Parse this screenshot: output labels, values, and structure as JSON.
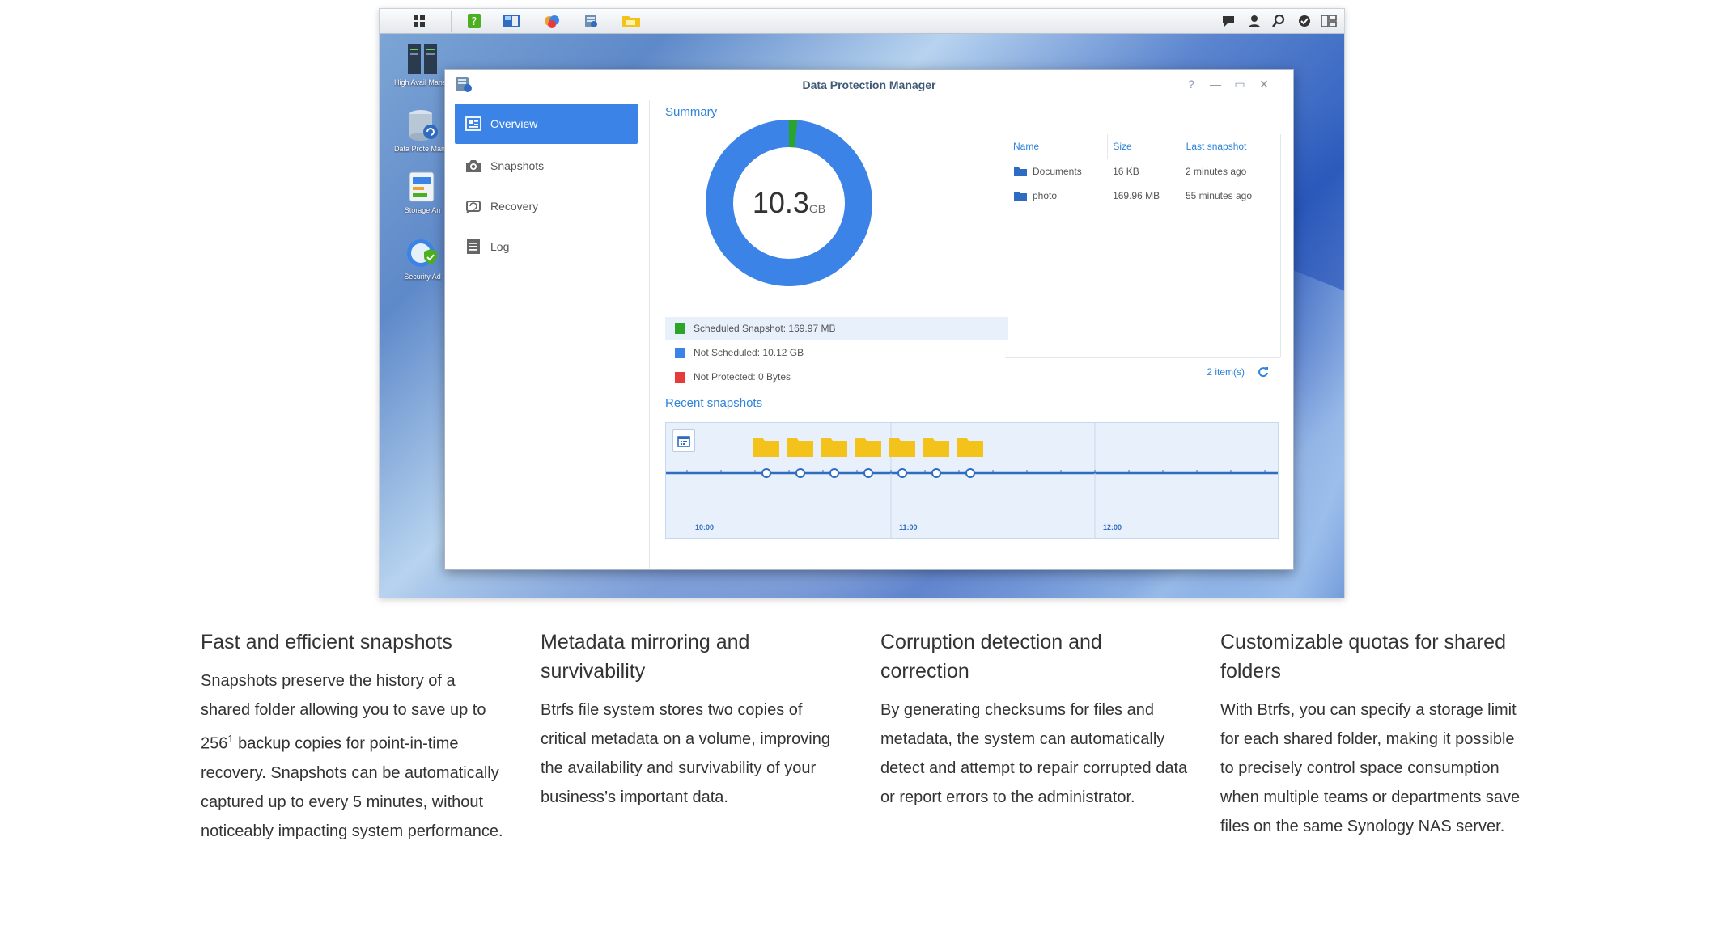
{
  "window": {
    "title": "Data Protection Manager",
    "help_label": "?",
    "minimize_label": "—",
    "maximize_label": "▭",
    "close_label": "✕"
  },
  "desktop_icons": [
    {
      "label": "High Avail Manag",
      "icon": "server-icon"
    },
    {
      "label": "Data Prote Manag",
      "icon": "database-icon"
    },
    {
      "label": "Storage An",
      "icon": "storage-analyzer-icon"
    },
    {
      "label": "Security Ad",
      "icon": "security-advisor-icon"
    }
  ],
  "sidebar": {
    "items": [
      {
        "label": "Overview",
        "icon": "overview-icon",
        "active": true
      },
      {
        "label": "Snapshots",
        "icon": "camera-icon",
        "active": false
      },
      {
        "label": "Recovery",
        "icon": "recovery-icon",
        "active": false
      },
      {
        "label": "Log",
        "icon": "log-icon",
        "active": false
      }
    ]
  },
  "summary": {
    "title": "Summary",
    "total_value": "10.3",
    "total_unit": "GB",
    "legend": [
      {
        "label": "Scheduled Snapshot: 169.97 MB",
        "color": "#2aa52a",
        "highlighted": true
      },
      {
        "label": "Not Scheduled: 10.12 GB",
        "color": "#3b83e6",
        "highlighted": false
      },
      {
        "label": "Not Protected: 0 Bytes",
        "color": "#e53b3b",
        "highlighted": false
      }
    ],
    "donut_fraction_scheduled": 0.016
  },
  "table": {
    "headers": [
      "Name",
      "Size",
      "Last snapshot"
    ],
    "rows": [
      {
        "name": "Documents",
        "size": "16 KB",
        "last": "2 minutes ago"
      },
      {
        "name": "photo",
        "size": "169.96 MB",
        "last": "55 minutes ago"
      }
    ],
    "footer": "2 item(s)"
  },
  "recent": {
    "title": "Recent snapshots",
    "ticks": [
      "10:00",
      "11:00",
      "12:00"
    ],
    "snapshot_count": 7
  },
  "features": [
    {
      "title": "Fast and efficient snapshots",
      "body_a": "Snapshots preserve the history of a shared folder allowing you to save up to 256",
      "footnote": "1",
      "body_b": " backup copies for point-in-time recovery. Snapshots can be automatically captured up to every 5 minutes, without noticeably impacting system performance."
    },
    {
      "title": "Metadata mirroring and survivability",
      "body": "Btrfs file system stores two copies of critical metadata on a volume, improving the availability and survivability of your business’s important data."
    },
    {
      "title": "Corruption detection and correction",
      "body": "By generating checksums for files and metadata, the system can automatically detect and attempt to repair corrupted data or report errors to the administrator."
    },
    {
      "title": "Customizable quotas for shared folders",
      "body": "With Btrfs, you can specify a storage limit for each shared folder, making it possible to precisely control space consumption when multiple teams or departments save files on the same Synology NAS server."
    }
  ]
}
